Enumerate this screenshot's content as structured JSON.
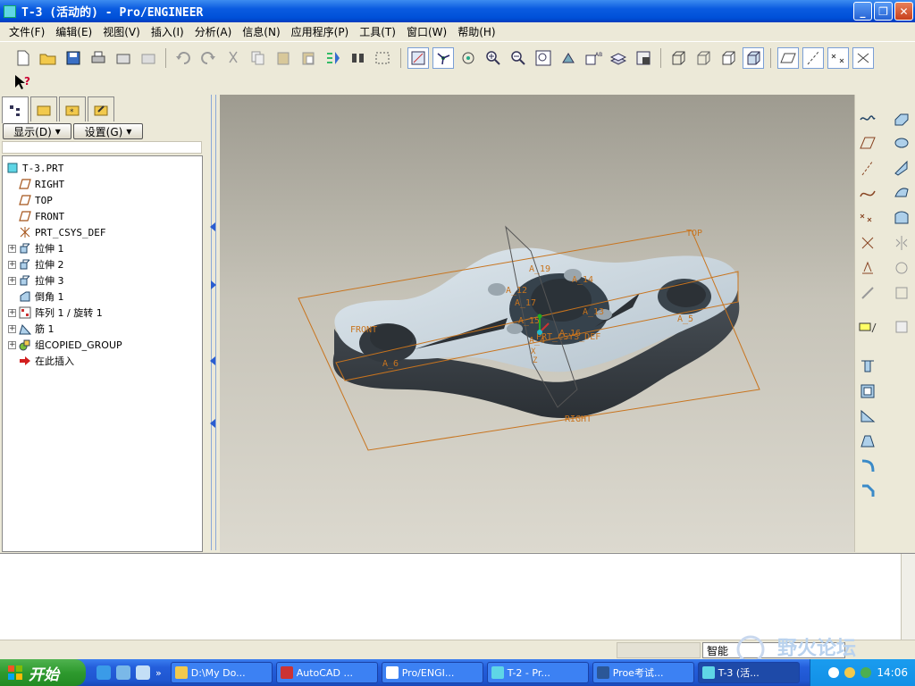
{
  "window": {
    "title": "T-3 (活动的) - Pro/ENGINEER",
    "min": "_",
    "max": "❐",
    "close": "✕"
  },
  "menu": [
    {
      "label": "文件(F)"
    },
    {
      "label": "编辑(E)"
    },
    {
      "label": "视图(V)"
    },
    {
      "label": "插入(I)"
    },
    {
      "label": "分析(A)"
    },
    {
      "label": "信息(N)"
    },
    {
      "label": "应用程序(P)"
    },
    {
      "label": "工具(T)"
    },
    {
      "label": "窗口(W)"
    },
    {
      "label": "帮助(H)"
    }
  ],
  "panel": {
    "show_btn": "显示(D)",
    "settings_btn": "设置(G)"
  },
  "tree": [
    {
      "label": "T-3.PRT",
      "icon": "part-icon",
      "indent": 0,
      "expander": false
    },
    {
      "label": "RIGHT",
      "icon": "datum-plane-icon",
      "indent": 1,
      "expander": false
    },
    {
      "label": "TOP",
      "icon": "datum-plane-icon",
      "indent": 1,
      "expander": false
    },
    {
      "label": "FRONT",
      "icon": "datum-plane-icon",
      "indent": 1,
      "expander": false
    },
    {
      "label": "PRT_CSYS_DEF",
      "icon": "csys-icon",
      "indent": 1,
      "expander": false
    },
    {
      "label": "拉伸 1",
      "icon": "extrude-icon",
      "indent": 1,
      "expander": true
    },
    {
      "label": "拉伸 2",
      "icon": "extrude-icon",
      "indent": 1,
      "expander": true
    },
    {
      "label": "拉伸 3",
      "icon": "extrude-icon",
      "indent": 1,
      "expander": true
    },
    {
      "label": "倒角 1",
      "icon": "chamfer-icon",
      "indent": 1,
      "expander": false
    },
    {
      "label": "阵列 1 / 旋转 1",
      "icon": "pattern-icon",
      "indent": 1,
      "expander": true
    },
    {
      "label": "筋 1",
      "icon": "rib-icon",
      "indent": 1,
      "expander": true
    },
    {
      "label": "组COPIED_GROUP",
      "icon": "group-icon",
      "indent": 1,
      "expander": true
    },
    {
      "label": "在此插入",
      "icon": "insert-here-icon",
      "indent": 1,
      "expander": false
    }
  ],
  "viewport": {
    "planes": {
      "top": "TOP",
      "front": "FRONT",
      "right": "RIGHT"
    },
    "axes": [
      "A_19",
      "A_14",
      "A_13",
      "A_12",
      "A_15",
      "A_16",
      "A_5",
      "A_6",
      "A_4",
      "A_17"
    ],
    "csys": "PRT_CSYS_DEF",
    "x_label": "X",
    "z_label": "Z"
  },
  "status": {
    "filter": "智能"
  },
  "taskbar": {
    "start": "开始",
    "tasks": [
      {
        "label": "D:\\My Do..."
      },
      {
        "label": "AutoCAD ..."
      },
      {
        "label": "Pro/ENGI..."
      },
      {
        "label": "T-2 - Pr..."
      },
      {
        "label": "Proe考试..."
      },
      {
        "label": "T-3 (活..."
      }
    ],
    "clock": "14:06"
  },
  "watermark": "野火论坛",
  "colors": {
    "title_blue": "#0a5be0",
    "datum_orange": "#c8741e",
    "part_light": "#c9d6df",
    "part_dark": "#3b4148",
    "start_green": "#2e9a2e"
  }
}
